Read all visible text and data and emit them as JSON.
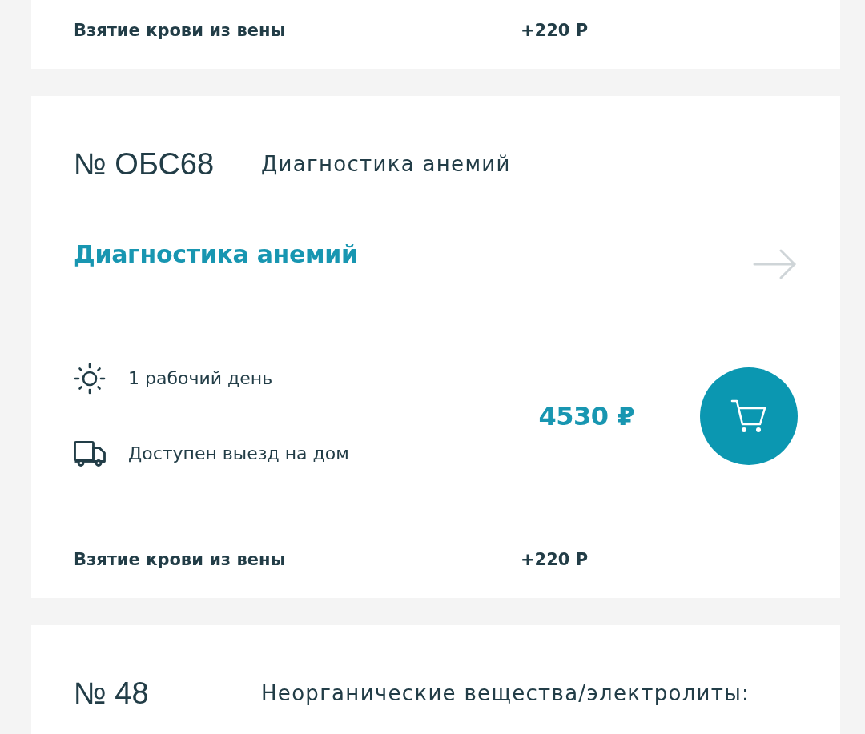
{
  "cards": [
    {
      "extra": {
        "label": "Взятие крови из вены",
        "price": "+220 Р"
      }
    },
    {
      "number": "№ ОБС68",
      "category": "Диагностика анемий",
      "title": "Диагностика анемий",
      "features": [
        {
          "kind": "turnaround",
          "text": "1 рабочий день"
        },
        {
          "kind": "home-visit",
          "text": "Доступен выезд на дом"
        }
      ],
      "price": "4530 ₽",
      "extra": {
        "label": "Взятие крови из вены",
        "price": "+220 Р"
      }
    },
    {
      "number": "№ 48",
      "category": "Неорганические вещества/электролиты:"
    }
  ]
}
